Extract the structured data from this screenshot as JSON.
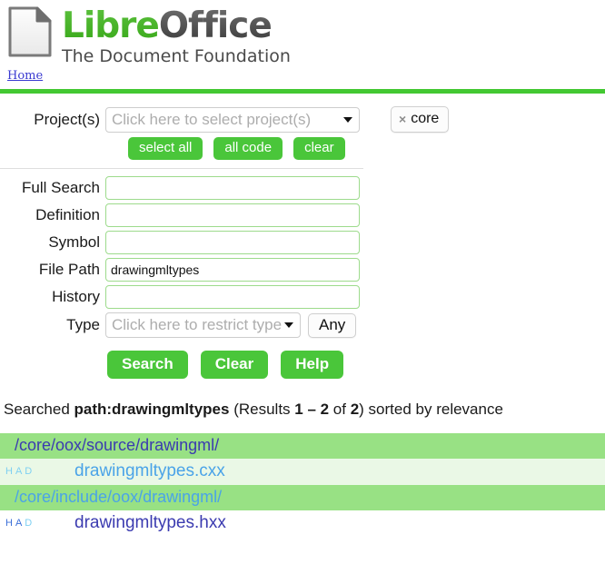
{
  "header": {
    "logo_icon": "document-icon",
    "title_part1": "Libre",
    "title_part2": "Office",
    "tagline": "The Document Foundation"
  },
  "nav": {
    "home_label": "Home"
  },
  "form": {
    "project_label": "Project(s)",
    "project_placeholder": "Click here to select project(s)",
    "project_tag_close": "×",
    "project_tag_label": "core",
    "select_all_label": "select all",
    "all_code_label": "all code",
    "clear_small_label": "clear",
    "fields": [
      {
        "label": "Full Search",
        "value": "",
        "name": "full-search-input"
      },
      {
        "label": "Definition",
        "value": "",
        "name": "definition-input"
      },
      {
        "label": "Symbol",
        "value": "",
        "name": "symbol-input"
      },
      {
        "label": "File Path",
        "value": "drawingmltypes",
        "name": "file-path-input"
      },
      {
        "label": "History",
        "value": "",
        "name": "history-input"
      }
    ],
    "type_label": "Type",
    "type_placeholder": "Click here to restrict type",
    "any_label": "Any",
    "search_label": "Search",
    "clear_label": "Clear",
    "help_label": "Help"
  },
  "summary": {
    "prefix": "Searched ",
    "query": "path:drawingmltypes",
    "results_open": " (Results ",
    "range": "1 – 2",
    "of": " of ",
    "total": "2",
    "suffix": ") sorted by relevance"
  },
  "results": [
    {
      "directory": "/core/oox/source/drawingml/",
      "dir_state": "visited",
      "flags": [
        "H",
        "A",
        "D"
      ],
      "flag_states": [
        "unvisited",
        "unvisited",
        "unvisited"
      ],
      "file": "drawingmltypes.cxx",
      "file_state": "unvisited",
      "row_shade": "alt"
    },
    {
      "directory": "/core/include/oox/drawingml/",
      "dir_state": "unvisited",
      "flags": [
        "H",
        "A",
        "D"
      ],
      "flag_states": [
        "visited",
        "visited",
        "unvisited"
      ],
      "file": "drawingmltypes.hxx",
      "file_state": "visited",
      "row_shade": "plain"
    }
  ],
  "colors": {
    "brand_green": "#43c832",
    "button_green": "#4ac63a",
    "dir_row_bg": "#98e184",
    "alt_row_bg": "#eaf8e6",
    "link_blue": "#4aa3e8",
    "visited_blue": "#3b3bb0"
  }
}
